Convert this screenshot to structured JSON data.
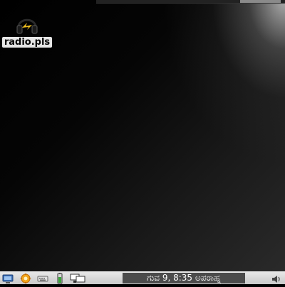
{
  "desktop": {
    "icons": [
      {
        "label": "radio.pls",
        "icon": "headphones-icon"
      }
    ]
  },
  "taskbar": {
    "launchers": [
      {
        "icon": "computer-icon"
      },
      {
        "icon": "settings-gear-icon"
      },
      {
        "icon": "keyboard-icon"
      },
      {
        "icon": "battery-icon"
      },
      {
        "icon": "network-icon"
      }
    ],
    "clock": "ಗುವ 9, 8:35 ಅಪರಾಹ್ನ",
    "tray_icon": "volume-icon"
  },
  "colors": {
    "taskbar_bg": "#d8d8d8",
    "clock_bg": "#4b4b4b",
    "desktop_bg": "#000000"
  }
}
